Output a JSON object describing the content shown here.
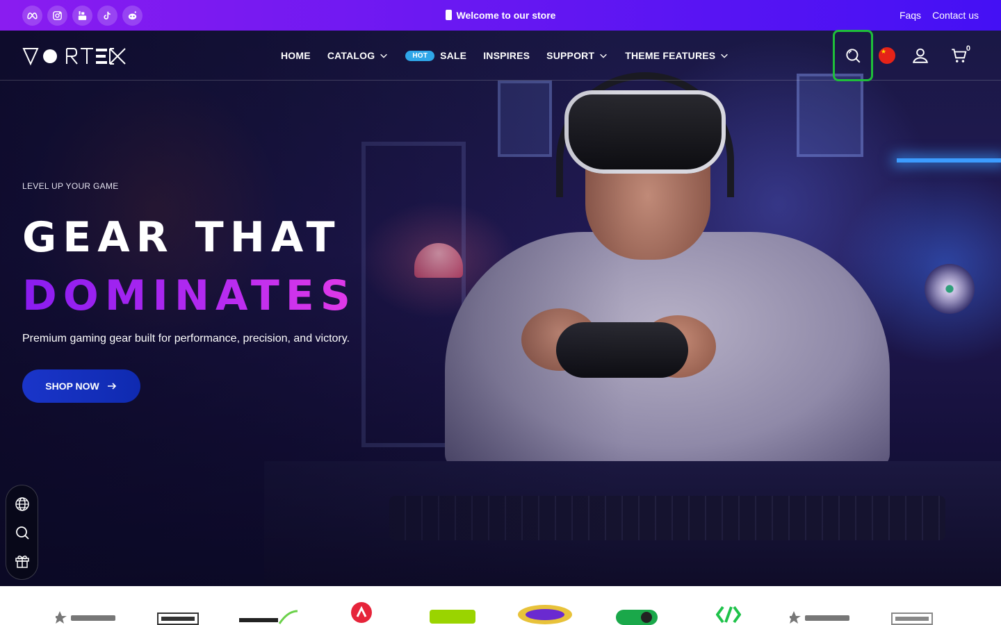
{
  "topbar": {
    "social": [
      {
        "icon": "meta-icon"
      },
      {
        "icon": "instagram-icon"
      },
      {
        "icon": "youtube-icon"
      },
      {
        "icon": "tiktok-icon"
      },
      {
        "icon": "reddit-icon"
      }
    ],
    "welcome": "Welcome to our store",
    "links": [
      "Faqs",
      "Contact us"
    ],
    "gradient": [
      "#8a1cf0",
      "#4410f4"
    ]
  },
  "header": {
    "logo": "VORTEX",
    "nav": [
      {
        "label": "HOME",
        "dropdown": false
      },
      {
        "label": "CATALOG",
        "dropdown": true
      },
      {
        "label": "SALE",
        "badge": "HOT",
        "dropdown": false
      },
      {
        "label": "INSPIRES",
        "dropdown": false
      },
      {
        "label": "SUPPORT",
        "dropdown": true
      },
      {
        "label": "THEME FEATURES",
        "dropdown": true
      }
    ],
    "icons": [
      "search-icon",
      "flag-china-icon",
      "account-icon",
      "cart-icon"
    ],
    "cart_count": "0",
    "highlight_color": "#1fbf3a"
  },
  "hero": {
    "eyebrow": "LEVEL UP YOUR GAME",
    "headline_1": "GEAR THAT",
    "headline_2": "DOMINATES",
    "subcopy": "Premium gaming gear built for performance, precision, and victory.",
    "cta": "SHOP NOW",
    "cta_color": "#1a35c9",
    "accent_gradient": [
      "#8a1cf0",
      "#e23ae8"
    ]
  },
  "floatbar": {
    "icons": [
      "globe-icon",
      "search-icon",
      "gift-icon"
    ]
  },
  "brands": []
}
